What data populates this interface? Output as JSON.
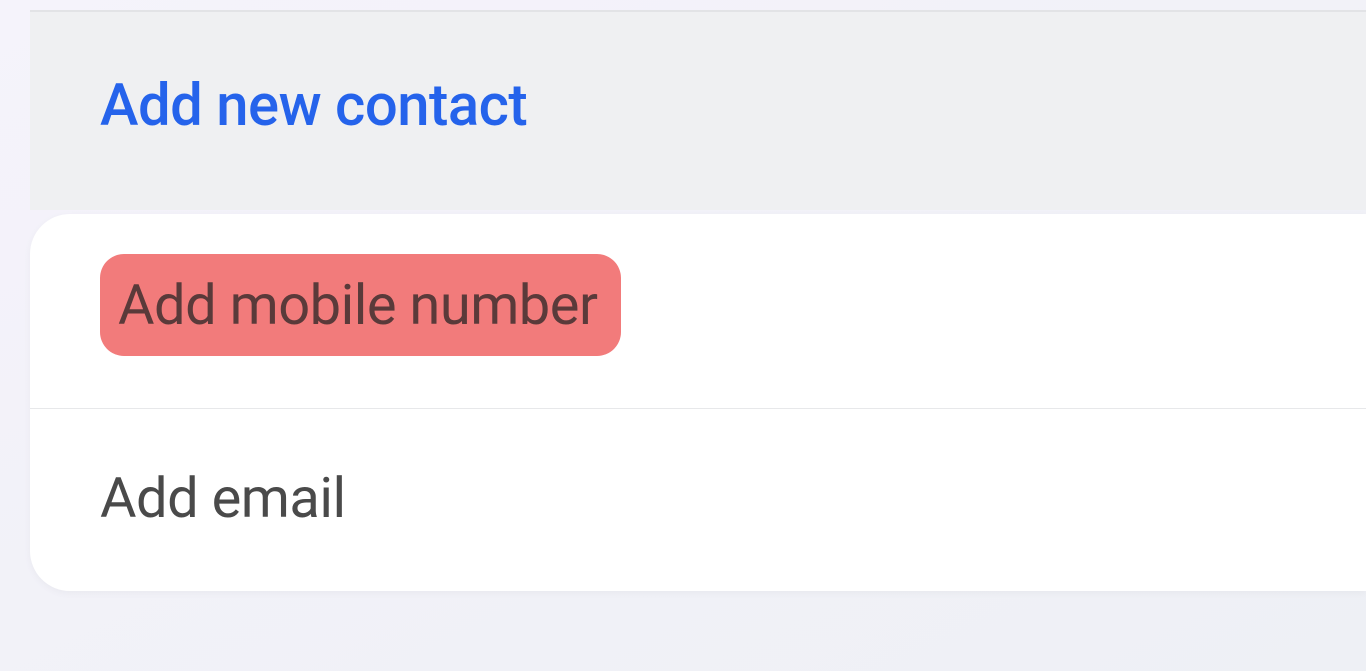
{
  "header": {
    "title": "Add new contact"
  },
  "fields": {
    "mobile": {
      "placeholder": "Add mobile number"
    },
    "email": {
      "placeholder": "Add email"
    }
  }
}
